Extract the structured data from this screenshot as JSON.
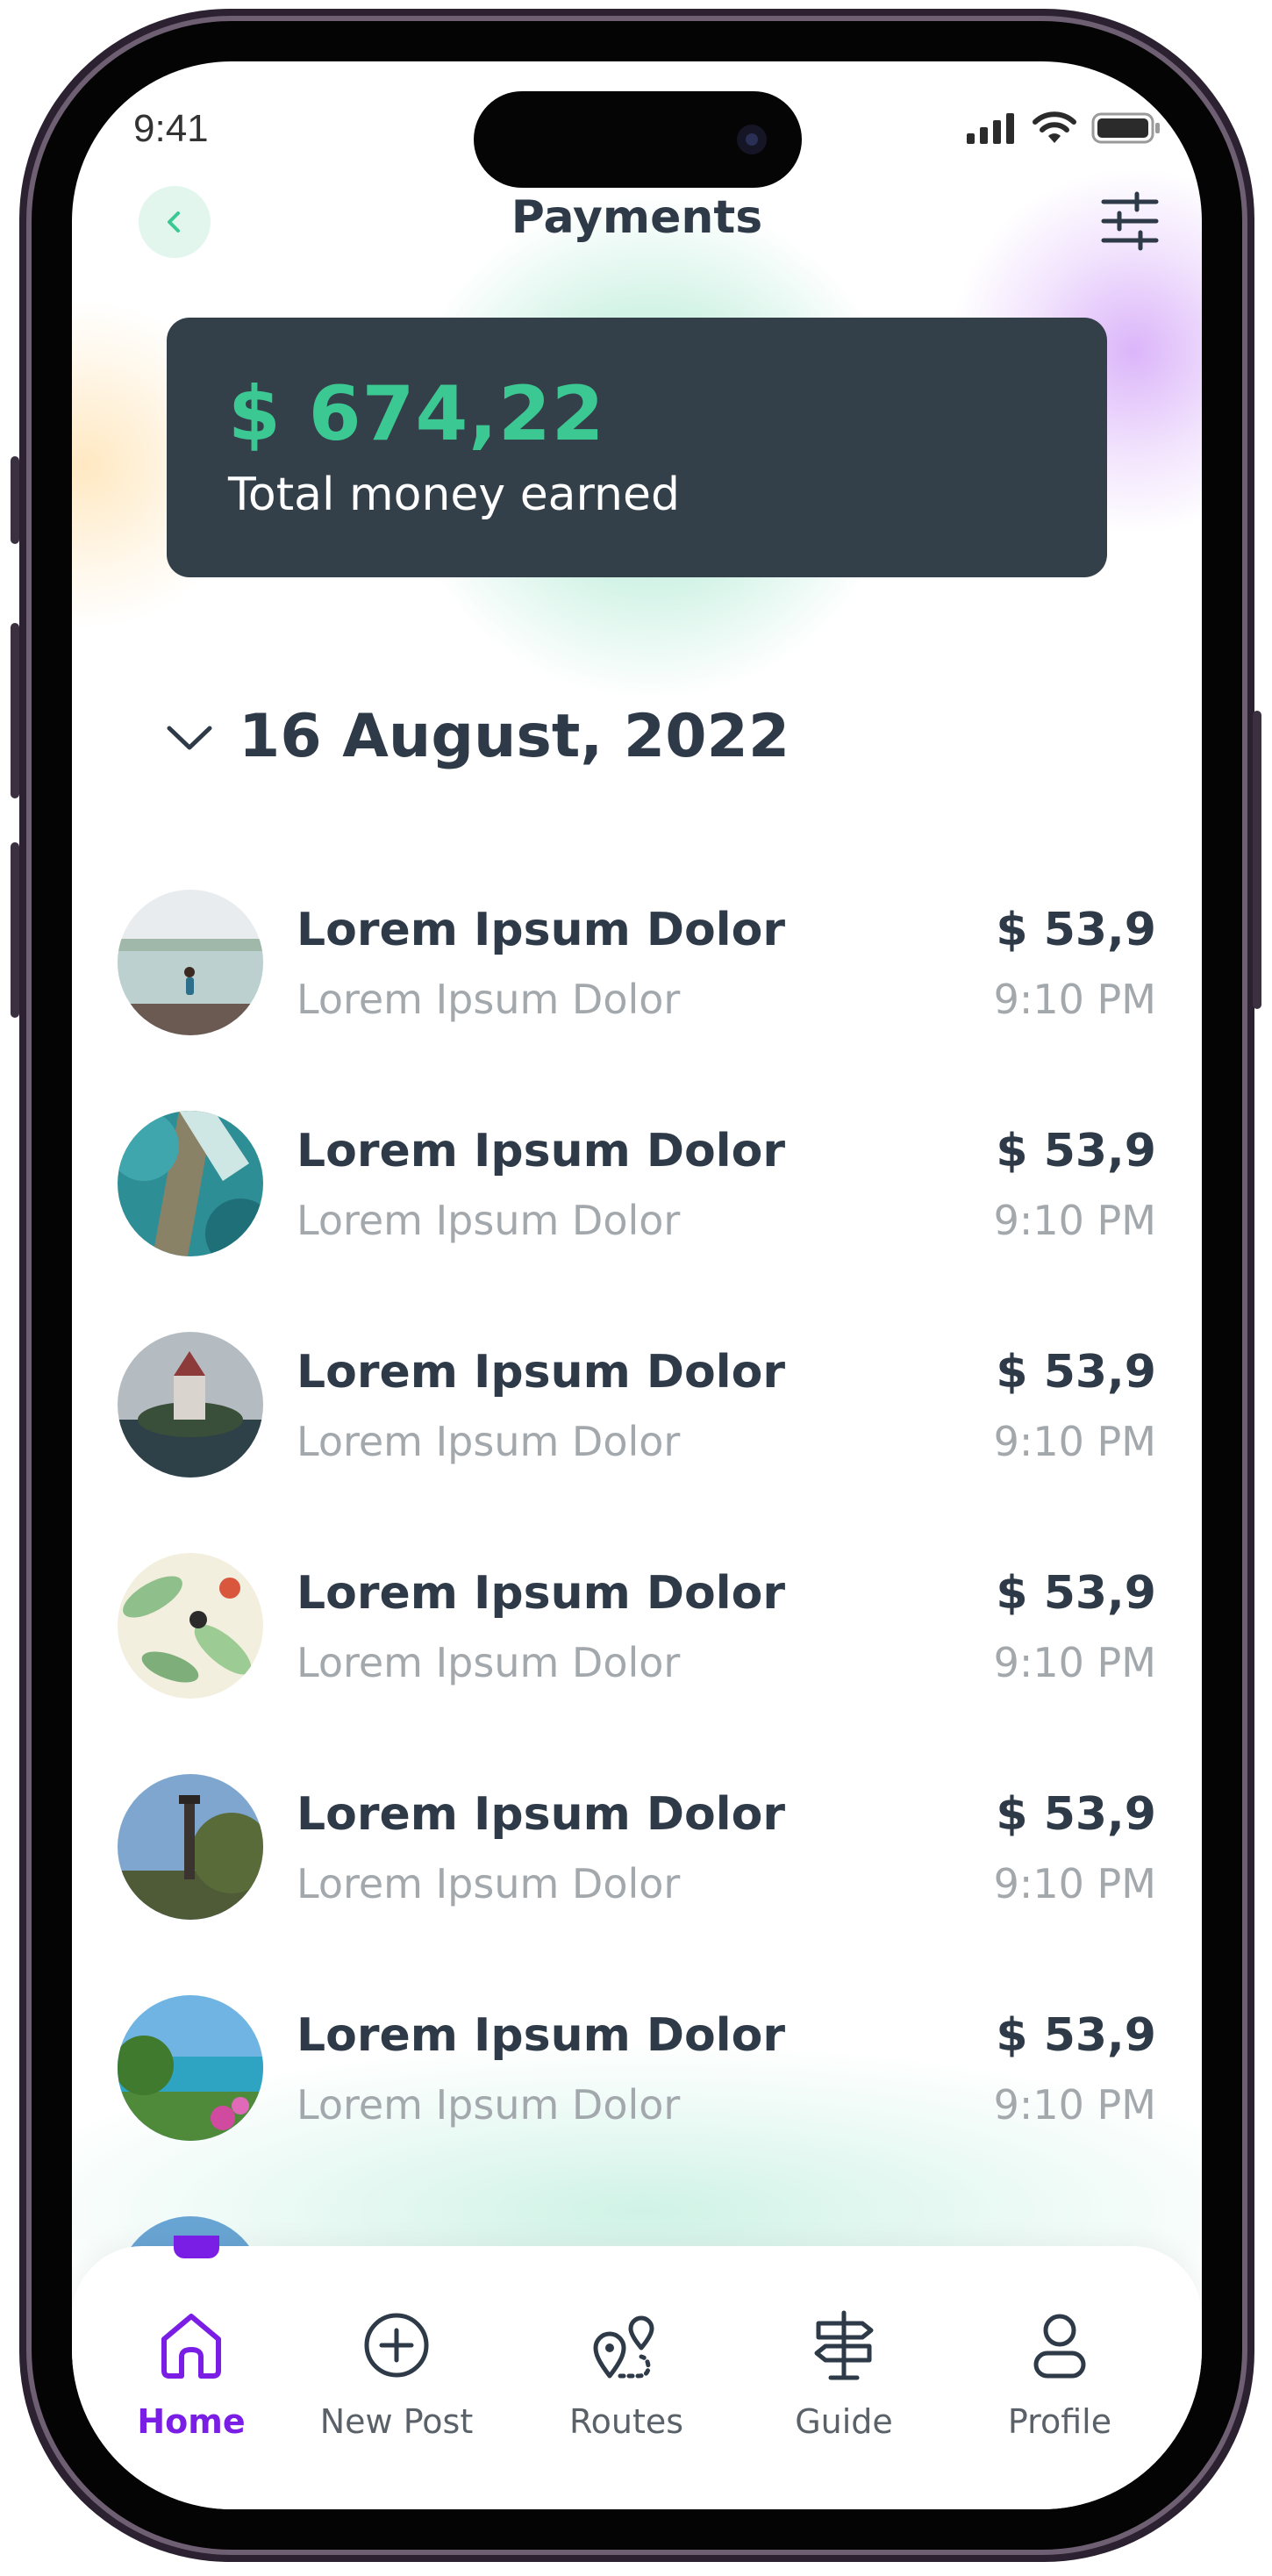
{
  "status_bar": {
    "time": "9:41"
  },
  "header": {
    "title": "Payments"
  },
  "summary": {
    "amount": "$ 674,22",
    "label": "Total money earned"
  },
  "date_group": {
    "label": "16 August, 2022"
  },
  "transactions": [
    {
      "title": "Lorem Ipsum Dolor",
      "subtitle": "Lorem Ipsum Dolor",
      "amount": "$ 53,9",
      "time": "9:10 PM",
      "thumbnail": "beach-swimmer"
    },
    {
      "title": "Lorem Ipsum Dolor",
      "subtitle": "Lorem Ipsum Dolor",
      "amount": "$ 53,9",
      "time": "9:10 PM",
      "thumbnail": "aerial-coast"
    },
    {
      "title": "Lorem Ipsum Dolor",
      "subtitle": "Lorem Ipsum Dolor",
      "amount": "$ 53,9",
      "time": "9:10 PM",
      "thumbnail": "castle-island"
    },
    {
      "title": "Lorem Ipsum Dolor",
      "subtitle": "Lorem Ipsum Dolor",
      "amount": "$ 53,9",
      "time": "9:10 PM",
      "thumbnail": "tropical-pattern"
    },
    {
      "title": "Lorem Ipsum Dolor",
      "subtitle": "Lorem Ipsum Dolor",
      "amount": "$ 53,9",
      "time": "9:10 PM",
      "thumbnail": "lighthouse"
    },
    {
      "title": "Lorem Ipsum Dolor",
      "subtitle": "Lorem Ipsum Dolor",
      "amount": "$ 53,9",
      "time": "9:10 PM",
      "thumbnail": "tropical-shore"
    }
  ],
  "nav": [
    {
      "label": "Home",
      "icon": "home-icon",
      "active": true
    },
    {
      "label": "New Post",
      "icon": "plus-circle-icon",
      "active": false
    },
    {
      "label": "Routes",
      "icon": "map-pin-route-icon",
      "active": false
    },
    {
      "label": "Guide",
      "icon": "signpost-icon",
      "active": false
    },
    {
      "label": "Profile",
      "icon": "user-icon",
      "active": false
    }
  ],
  "colors": {
    "accent": "#3cc893",
    "active_nav": "#7a1ee6",
    "card_bg": "#344049",
    "text_dark": "#2e3a48",
    "text_muted": "#a3a8ad"
  }
}
